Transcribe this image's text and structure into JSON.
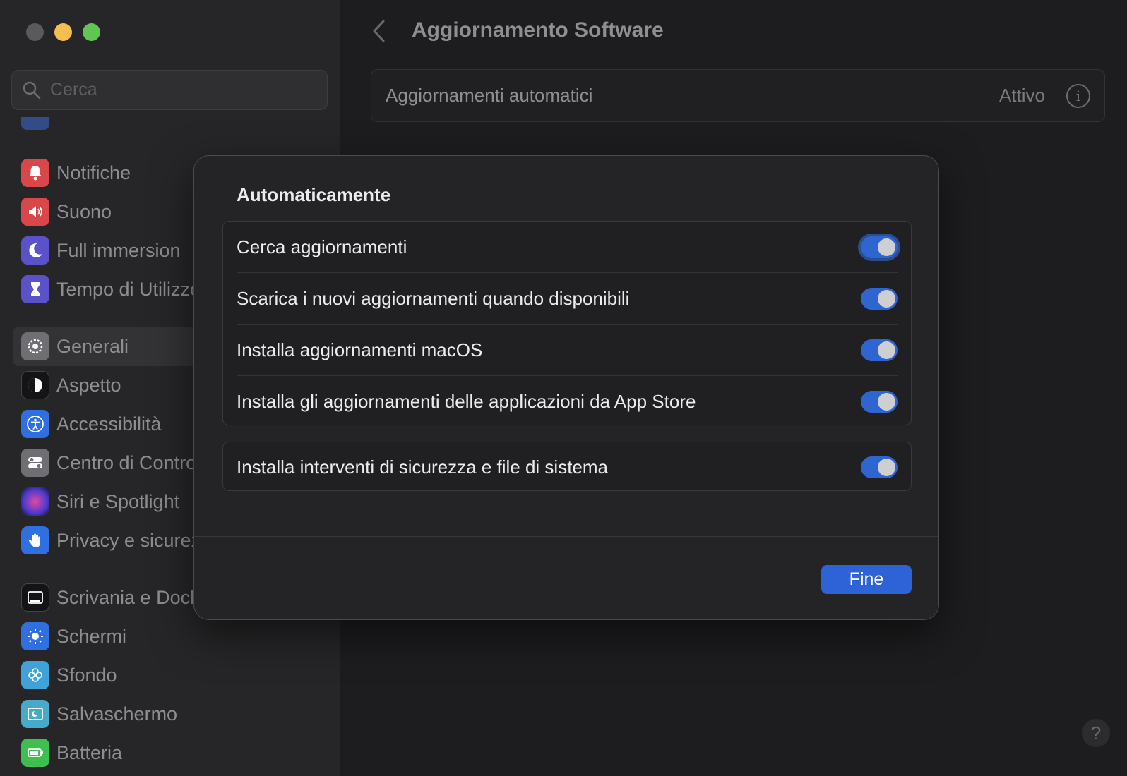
{
  "window": {
    "traffic_lights": [
      "close",
      "minimize",
      "maximize"
    ]
  },
  "sidebar": {
    "search": {
      "placeholder": "Cerca",
      "value": ""
    },
    "items": [
      {
        "label": "Notifiche",
        "icon": "bell-icon",
        "color": "#e0464a"
      },
      {
        "label": "Suono",
        "icon": "speaker-icon",
        "color": "#e0464a"
      },
      {
        "label": "Full immersion",
        "icon": "moon-icon",
        "color": "#5b52c9"
      },
      {
        "label": "Tempo di Utilizzo",
        "icon": "hourglass-icon",
        "color": "#5b52c9"
      },
      {
        "label": "Generali",
        "icon": "gear-icon",
        "color": "#8e8e93"
      },
      {
        "label": "Aspetto",
        "icon": "appearance-icon",
        "color": "#1c1c1e"
      },
      {
        "label": "Accessibilità",
        "icon": "accessibility-icon",
        "color": "#2f6fe0"
      },
      {
        "label": "Centro di Controllo",
        "icon": "toggles-icon",
        "color": "#8e8e93"
      },
      {
        "label": "Siri e Spotlight",
        "icon": "siri-icon",
        "color": "#9a4fd0"
      },
      {
        "label": "Privacy e sicurezza",
        "icon": "hand-icon",
        "color": "#2f6fe0"
      },
      {
        "label": "Scrivania e Dock",
        "icon": "dock-icon",
        "color": "#1c1c1e"
      },
      {
        "label": "Schermi",
        "icon": "sun-icon",
        "color": "#2f6fe0"
      },
      {
        "label": "Sfondo",
        "icon": "flower-icon",
        "color": "#3fa3d8"
      },
      {
        "label": "Salvaschermo",
        "icon": "screensaver-icon",
        "color": "#49a9c9"
      },
      {
        "label": "Batteria",
        "icon": "battery-icon",
        "color": "#3fbf4e"
      }
    ]
  },
  "main": {
    "title": "Aggiornamento Software",
    "auto_updates": {
      "label": "Aggiornamenti automatici",
      "value": "Attivo"
    },
    "help_label": "?"
  },
  "dialog": {
    "title": "Automaticamente",
    "group1": [
      {
        "label": "Cerca aggiornamenti",
        "on": true
      },
      {
        "label": "Scarica i nuovi aggiornamenti quando disponibili",
        "on": true
      },
      {
        "label": "Installa aggiornamenti macOS",
        "on": true
      },
      {
        "label": "Installa gli aggiornamenti delle applicazioni da App Store",
        "on": true
      }
    ],
    "group2": [
      {
        "label": "Installa interventi di sicurezza e file di sistema",
        "on": true
      }
    ],
    "done_label": "Fine"
  },
  "colors": {
    "accent": "#2d63d6",
    "toggle_on": "#2f65d0"
  }
}
